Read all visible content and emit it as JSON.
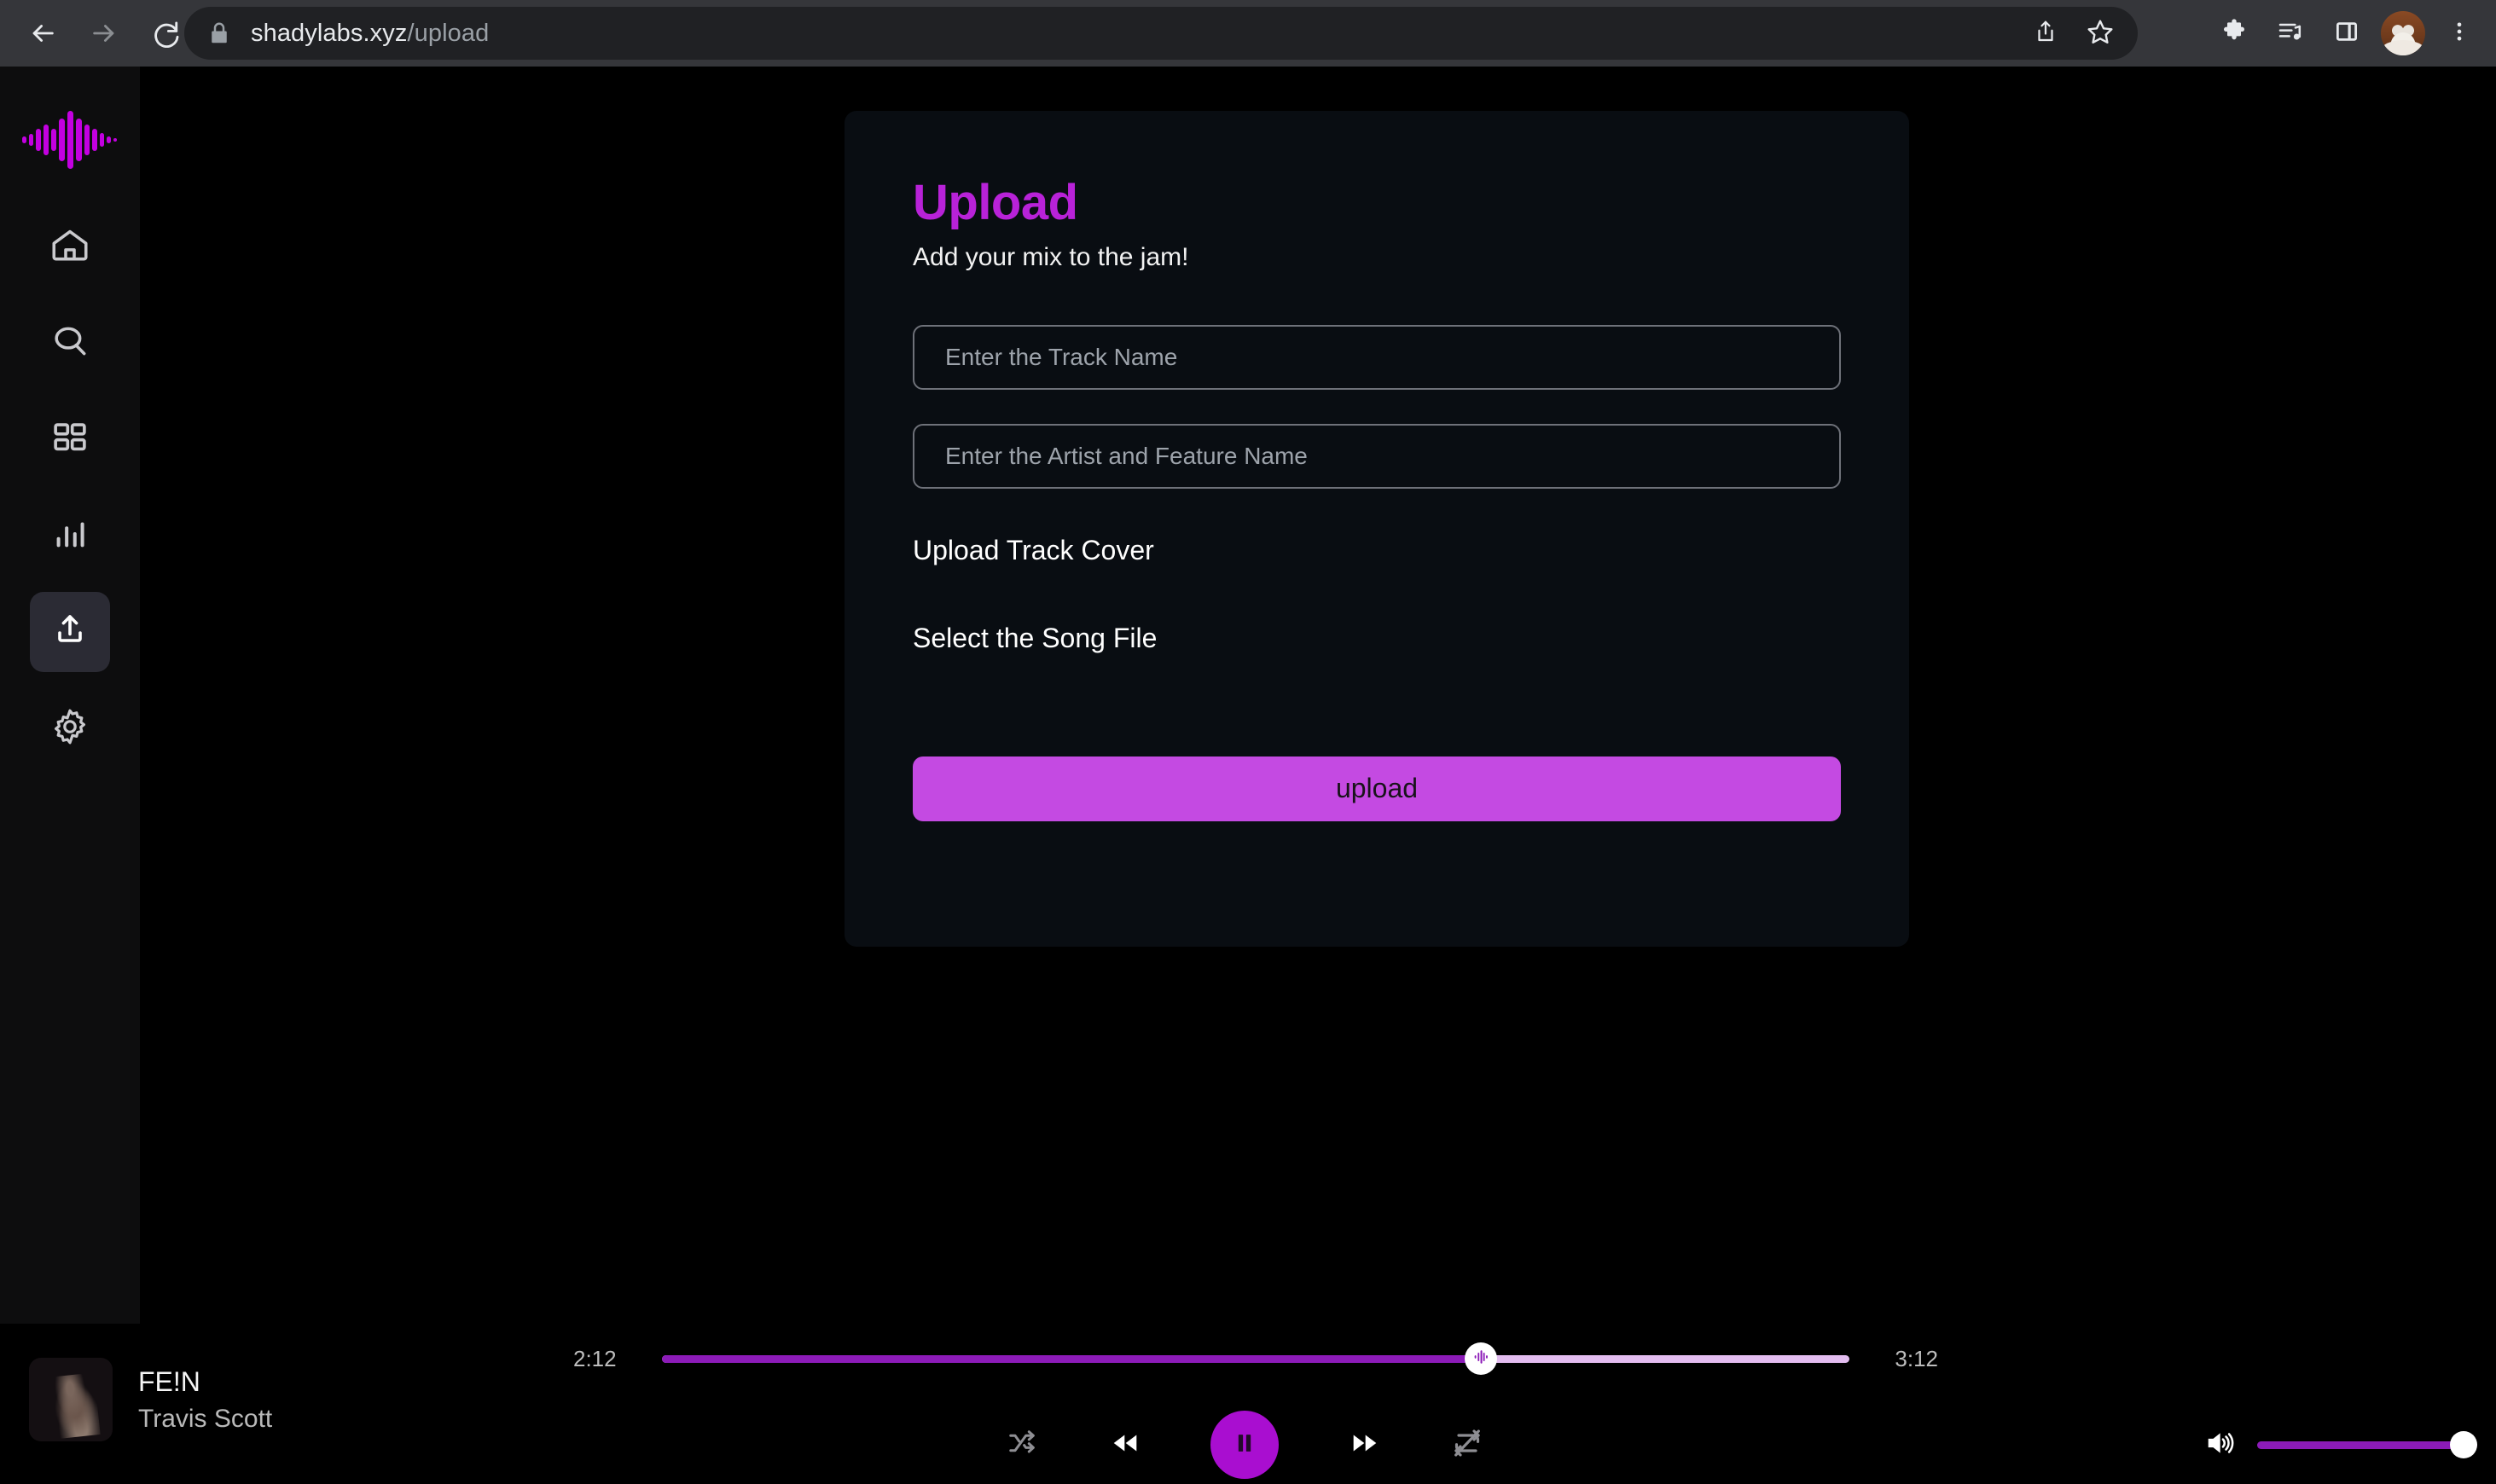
{
  "browser": {
    "url_domain": "shadylabs.xyz",
    "url_path": "/upload",
    "back_icon": "back-arrow-icon",
    "forward_icon": "forward-arrow-icon",
    "reload_icon": "reload-icon",
    "lock_icon": "lock-icon",
    "share_icon": "share-icon",
    "bookmark_icon": "star-icon",
    "extensions_icon": "puzzle-icon",
    "media_icon": "playlist-music-icon",
    "side_panel_icon": "side-panel-icon",
    "profile_icon": "profile-avatar",
    "menu_icon": "three-dot-menu-icon"
  },
  "sidebar": {
    "logo": "waveform-logo",
    "items": [
      {
        "name": "home",
        "icon": "home-icon",
        "active": false
      },
      {
        "name": "search",
        "icon": "search-icon",
        "active": false
      },
      {
        "name": "library",
        "icon": "grid-icon",
        "active": false
      },
      {
        "name": "stats",
        "icon": "bar-chart-icon",
        "active": false
      },
      {
        "name": "upload",
        "icon": "upload-icon",
        "active": true
      },
      {
        "name": "settings",
        "icon": "gear-icon",
        "active": false
      }
    ]
  },
  "upload": {
    "title": "Upload",
    "subtitle": "Add your mix to the jam!",
    "track_name_value": "",
    "track_name_placeholder": "Enter the Track Name",
    "artist_value": "",
    "artist_placeholder": "Enter the Artist and Feature Name",
    "cover_label": "Upload Track Cover",
    "song_file_label": "Select the Song File",
    "submit_label": "upload",
    "accent_color": "#b822d8",
    "button_color": "#c44ae2"
  },
  "player": {
    "track_title": "FE!N",
    "track_artist": "Travis Scott",
    "current_time": "2:12",
    "total_time": "3:12",
    "progress_percent": 69,
    "volume_percent": 100,
    "is_playing": true,
    "shuffle_icon": "shuffle-icon",
    "previous_icon": "rewind-icon",
    "play_pause_icon": "pause-icon",
    "next_icon": "fast-forward-icon",
    "repeat_icon": "repeat-off-icon",
    "volume_icon": "volume-high-icon",
    "handle_icon": "waveform-handle-icon",
    "accent_color": "#8c1bb8"
  }
}
